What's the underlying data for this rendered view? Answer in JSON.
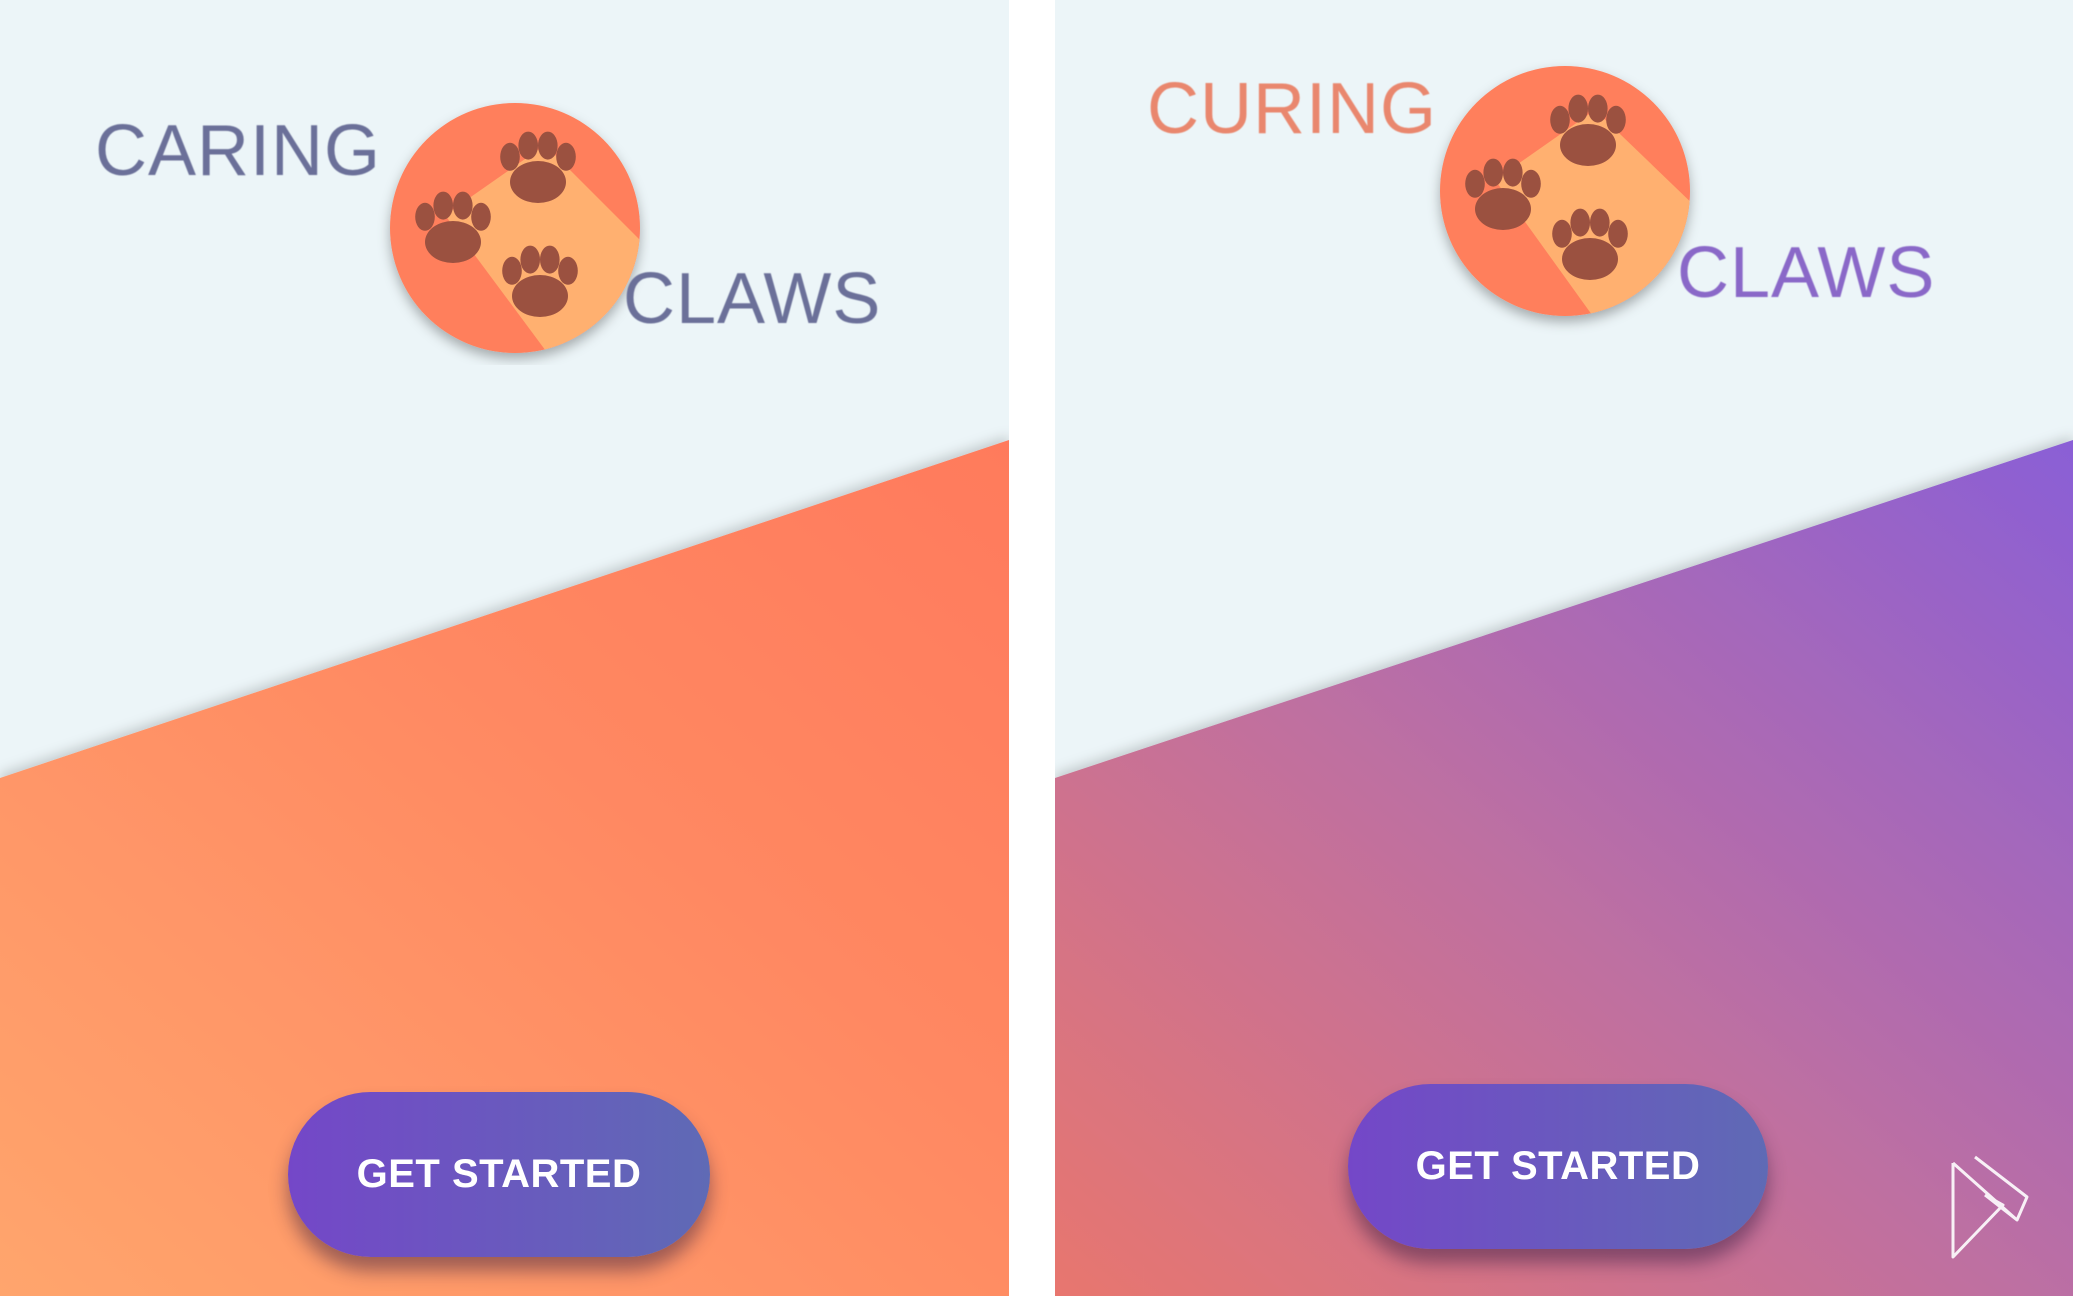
{
  "screens": [
    {
      "title_word_1": "CARING",
      "title_word_2": "CLAWS",
      "button_label": "GET STARTED",
      "colors": {
        "background": "#ecf5f8",
        "word_1": "#6b7099",
        "word_2": "#6b7099",
        "gradient_start": "#ffa56d",
        "gradient_end": "#ff7a5c",
        "button_start": "#7447c8",
        "button_end": "#5f6ab5"
      }
    },
    {
      "title_word_1": "CURING",
      "title_word_2": "CLAWS",
      "button_label": "GET STARTED",
      "colors": {
        "background": "#ecf5f8",
        "word_1": "#e9876e",
        "word_2": "#8a68c8",
        "gradient_start": "#e8766e",
        "gradient_end": "#8a5fd6",
        "button_start": "#7447c8",
        "button_end": "#5f6ab5"
      }
    }
  ],
  "logo": {
    "icon": "paw-prints-icon",
    "colors": {
      "circle": "#ff7f5c",
      "stripe": "#ffb070",
      "paw": "#9b5140"
    }
  },
  "watermark": {
    "icon": "play-logo-icon",
    "color": "#ffffff"
  }
}
